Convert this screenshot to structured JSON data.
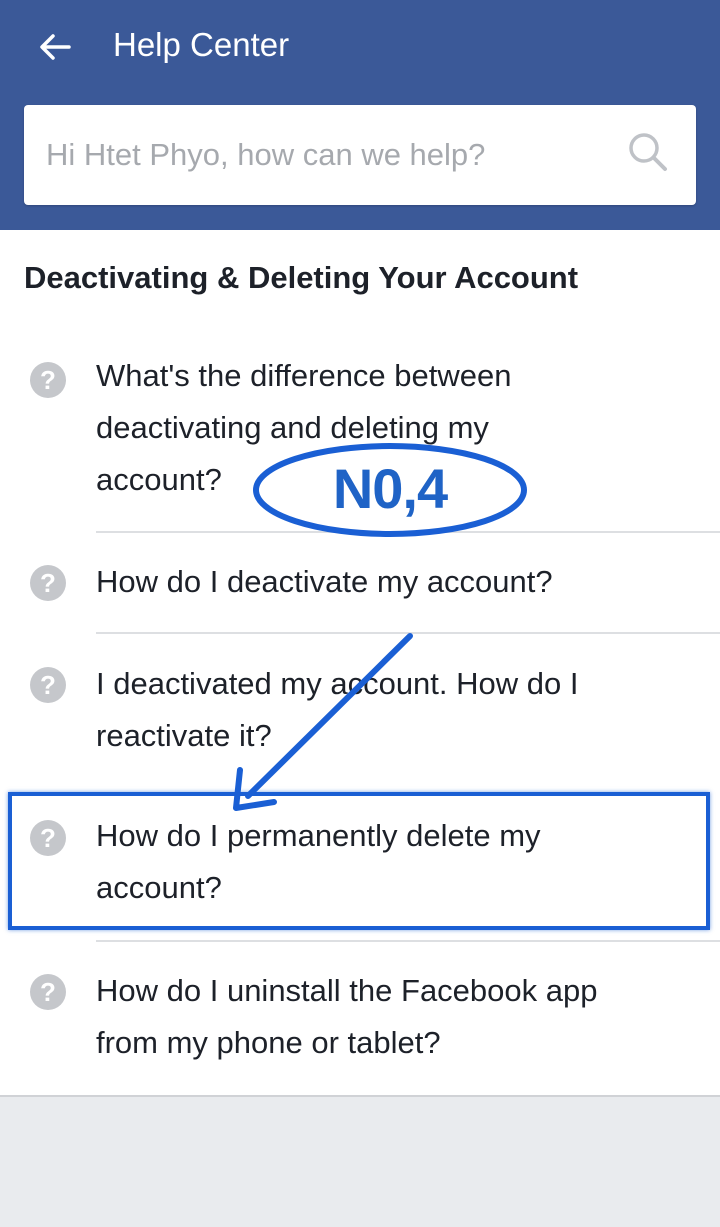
{
  "header": {
    "title": "Help Center",
    "back_icon": "back-arrow-icon"
  },
  "search": {
    "placeholder": "Hi Htet Phyo, how can we help?",
    "icon": "search-icon"
  },
  "section": {
    "title": "Deactivating & Deleting Your Account"
  },
  "faq": {
    "icon": "question-circle-icon",
    "icon_glyph": "?",
    "items": [
      {
        "line1": "What's the difference between",
        "line2": "deactivating and deleting my",
        "line3": "account?"
      },
      {
        "line1": "How do I deactivate my account?"
      },
      {
        "line1": "I deactivated my account. How do I",
        "line2": "reactivate it?"
      },
      {
        "line1": "How do I permanently delete my",
        "line2": "account?"
      },
      {
        "line1": "How do I uninstall the Facebook app",
        "line2": "from my phone or tablet?"
      }
    ]
  },
  "annotation": {
    "label": "N0,4",
    "color": "#1a5fd4",
    "highlighted_item": "How do I permanently delete my account?"
  },
  "colors": {
    "header_bg": "#3b5998",
    "page_bg": "#e9ebee",
    "icon_gray": "#c5c7cb",
    "text": "#1d2129"
  }
}
